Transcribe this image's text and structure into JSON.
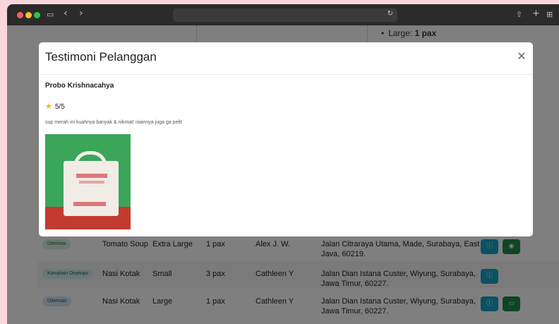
{
  "browser": {
    "reload_icon": "↻",
    "sidebar_icon": "▭",
    "back_icon": "‹",
    "forward_icon": "›",
    "share_icon": "⇧",
    "newtab_icon": "+",
    "tabs_icon": "⊞"
  },
  "background": {
    "size_label": "Large:",
    "size_value": "1 pax",
    "rows": [
      {
        "status": "Diterima",
        "product": "Tomato Soup",
        "size": "Extra Large",
        "qty": "1 pax",
        "customer": "Alex J. W.",
        "address_1": "Jalan Citraraya Utama, Made, Surabaya, East",
        "address_2": "Java, 60219."
      },
      {
        "status": "Komplain Disetujui",
        "product": "Nasi Kotak",
        "size": "Small",
        "qty": "3 pax",
        "customer": "Cathleen Y",
        "address_1": "Jalan Dian Istana Custer, Wiyung, Surabaya,",
        "address_2": "Jawa Timur, 60227."
      },
      {
        "status": "Dikemas",
        "product": "Nasi Kotak",
        "size": "Large",
        "qty": "1 pax",
        "customer": "Cathleen Y",
        "address_1": "Jalan Dian Istana Custer, Wiyung, Surabaya,",
        "address_2": "Jawa Timur, 60227."
      }
    ],
    "info_icon": "ⓘ",
    "eye_icon": "◉",
    "truck_icon": "▭"
  },
  "modal": {
    "title": "Testimoni Pelanggan",
    "close_icon": "✕",
    "name": "Probo Krishnacahya",
    "star_icon": "★",
    "rating": "5/5",
    "comment": "sup merah ini kuahnya banyak & nikmat! isiannya juga ga pelit"
  }
}
